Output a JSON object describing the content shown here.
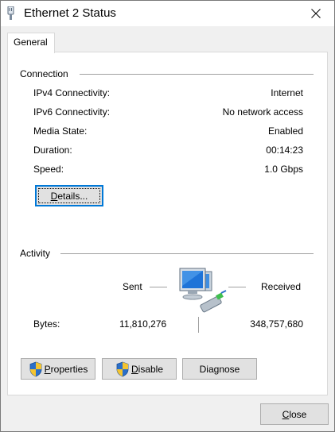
{
  "window": {
    "title": "Ethernet 2 Status"
  },
  "tabs": [
    {
      "label": "General"
    }
  ],
  "connection": {
    "label": "Connection",
    "rows": [
      {
        "label": "IPv4 Connectivity:",
        "value": "Internet"
      },
      {
        "label": "IPv6 Connectivity:",
        "value": "No network access"
      },
      {
        "label": "Media State:",
        "value": "Enabled"
      },
      {
        "label": "Duration:",
        "value": "00:14:23"
      },
      {
        "label": "Speed:",
        "value": "1.0 Gbps"
      }
    ],
    "details_button": {
      "label": "Details...",
      "mnemonic": "D",
      "rest": "etails..."
    }
  },
  "activity": {
    "label": "Activity",
    "sent_label": "Sent",
    "received_label": "Received",
    "bytes_label": "Bytes:",
    "bytes_sent": "11,810,276",
    "bytes_received": "348,757,680"
  },
  "buttons": {
    "properties": {
      "label": "Properties",
      "mnemonic": "P",
      "rest": "roperties"
    },
    "disable": {
      "label": "Disable",
      "mnemonic": "D",
      "rest": "isable"
    },
    "diagnose": {
      "label": "Diagnose",
      "prefix": "Dia",
      "mnemonic": "g",
      "rest": "nose"
    },
    "close": {
      "label": "Close",
      "mnemonic": "C",
      "rest": "lose"
    }
  },
  "colors": {
    "accent": "#0078d7",
    "shield_blue": "#2a6fc9",
    "shield_yellow": "#f4c430",
    "monitor_blue": "#1e73d8"
  },
  "icons": [
    "network-adapter-icon",
    "close-icon",
    "shield-icon",
    "network-computers-icon"
  ]
}
